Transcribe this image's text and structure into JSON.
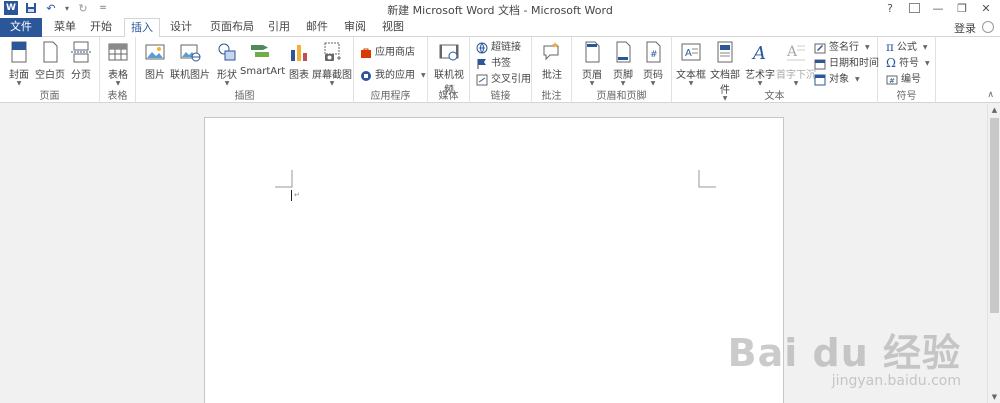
{
  "window": {
    "title": "新建 Microsoft Word 文档 - Microsoft Word",
    "help_glyph": "?",
    "restore_ribbon_glyph": "⊡",
    "minimize_glyph": "—",
    "maximize_glyph": "❐",
    "close_glyph": "✕"
  },
  "qat": {
    "app_icon_letter": "W",
    "save_glyph": "💾",
    "undo_glyph": "↶",
    "undo_dd": "▾",
    "redo_glyph": "↻",
    "customize_glyph": "⩡"
  },
  "tabs": [
    {
      "label": "文件"
    },
    {
      "label": "菜单"
    },
    {
      "label": "开始"
    },
    {
      "label": "插入"
    },
    {
      "label": "设计"
    },
    {
      "label": "页面布局"
    },
    {
      "label": "引用"
    },
    {
      "label": "邮件"
    },
    {
      "label": "审阅"
    },
    {
      "label": "视图"
    }
  ],
  "account": {
    "login_label": "登录"
  },
  "ribbon": {
    "pages": {
      "label": "页面",
      "cover": "封面",
      "blank": "空白页",
      "break": "分页"
    },
    "tables": {
      "label": "表格",
      "table": "表格"
    },
    "illustrations": {
      "label": "插图",
      "picture": "图片",
      "online_picture": "联机图片",
      "shapes": "形状",
      "smartart": "SmartArt",
      "chart": "图表",
      "screenshot": "屏幕截图"
    },
    "apps": {
      "label": "应用程序",
      "store": "应用商店",
      "my_apps": "我的应用"
    },
    "media": {
      "label": "媒体",
      "online_video": "联机视频"
    },
    "links": {
      "label": "链接",
      "hyperlink": "超链接",
      "bookmark": "书签",
      "cross_ref": "交叉引用"
    },
    "comments": {
      "label": "批注",
      "comment": "批注"
    },
    "header_footer": {
      "label": "页眉和页脚",
      "header": "页眉",
      "footer": "页脚",
      "page_number": "页码"
    },
    "text": {
      "label": "文本",
      "textbox": "文本框",
      "quickparts": "文档部件",
      "wordart": "艺术字",
      "dropcap": "首字下沉",
      "signature": "签名行",
      "datetime": "日期和时间",
      "object": "对象"
    },
    "symbols": {
      "label": "符号",
      "equation": "公式",
      "symbol": "符号",
      "number": "编号"
    },
    "collapse_glyph": "∧"
  },
  "document": {
    "paragraph_mark": "↵"
  },
  "scrollbar": {
    "up": "▲",
    "down": "▼"
  },
  "watermark": {
    "brand": "Bai du 经验",
    "url": "jingyan.baidu.com"
  },
  "colors": {
    "accent": "#2b579a",
    "ribbon_bg": "#ffffff",
    "doc_bg": "#f1f1f1"
  }
}
